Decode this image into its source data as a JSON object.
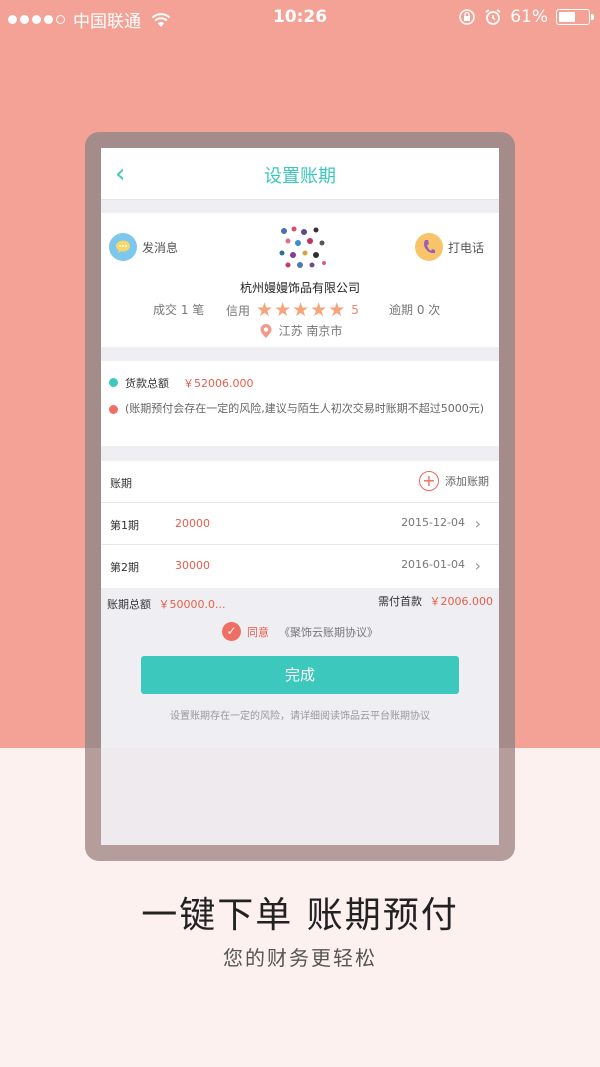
{
  "status_bar": {
    "carrier": "中国联通",
    "time": "10:26",
    "battery": "61%",
    "battery_level": 0.61
  },
  "nav": {
    "title": "设置账期"
  },
  "shop": {
    "send_message": "发消息",
    "call": "打电话",
    "name": "杭州嫚嫚饰品有限公司",
    "deals": "成交 1 笔",
    "credit_label": "信用",
    "rating": "5",
    "overdue": "逾期 0 次",
    "location": "江苏 南京市"
  },
  "amount": {
    "total_label": "货款总额",
    "total_value": "￥52006.000",
    "warning": "(账期预付会存在一定的风险,建议与陌生人初次交易时账期不超过5000元)"
  },
  "period": {
    "label": "账期",
    "add_label": "添加账期",
    "items": [
      {
        "label": "第1期",
        "amount": "20000",
        "date": "2015-12-04"
      },
      {
        "label": "第2期",
        "amount": "30000",
        "date": "2016-01-04"
      }
    ]
  },
  "totals": {
    "period_total_label": "账期总额",
    "period_total_value": "￥50000.0...",
    "down_payment_label": "需付首款",
    "down_payment_value": "￥2006.000"
  },
  "agreement": {
    "agree_label": "同意",
    "agreement_link": "《聚饰云账期协议》"
  },
  "done_button": "完成",
  "note": "设置账期存在一定的风险，请详细阅读饰品云平台账期协议",
  "promo": {
    "headline": "一键下单 账期预付",
    "subline": "您的财务更轻松"
  },
  "colors": {
    "accent": "#3cc8bd",
    "background_top": "#f4a295",
    "background_bottom": "#fdf1ef",
    "highlight": "#e85d4a"
  }
}
